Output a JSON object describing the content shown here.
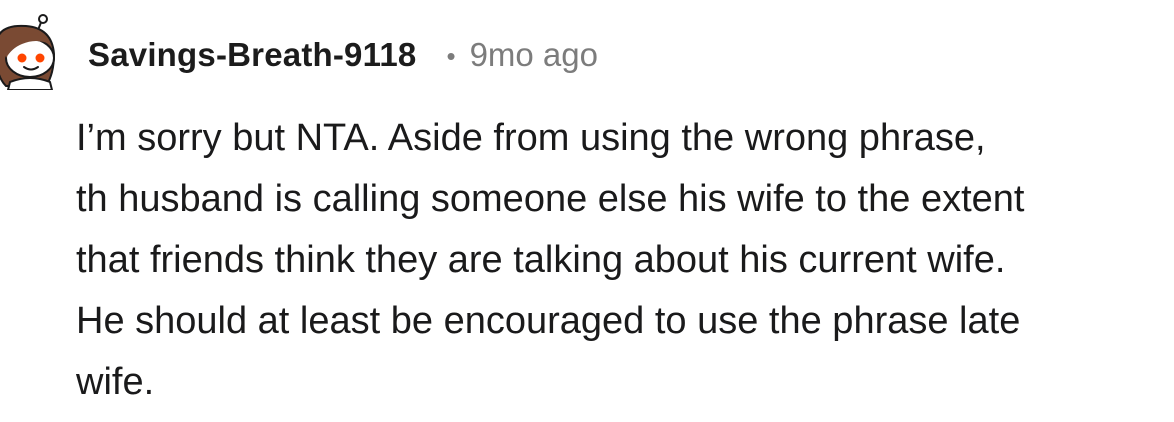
{
  "comment": {
    "author": {
      "username": "Savings-Breath-9118",
      "avatar_icon": "snoo-avatar-icon"
    },
    "separator": "•",
    "timestamp": "9mo ago",
    "body_lines": [
      "I’m sorry but NTA. Aside from using the wrong phrase,",
      "th husband is calling someone else his wife to the extent",
      "that friends think they are talking about his current wife.",
      "He should at least be encouraged to use the phrase late",
      "wife."
    ]
  },
  "colors": {
    "text": "#1a1a1b",
    "meta": "#7c7c7c",
    "avatar_accent": "#ff4500"
  }
}
